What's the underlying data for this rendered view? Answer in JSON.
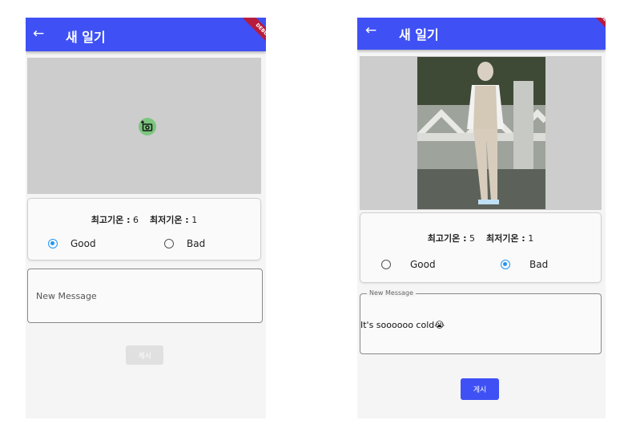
{
  "left": {
    "appbar": {
      "back_icon": "arrow-left-icon",
      "title": "새 일기",
      "debug_banner": "DEBUG"
    },
    "photo": {
      "empty": true,
      "camera_icon": "add-a-photo-icon"
    },
    "weather": {
      "max_label": "최고기온 :",
      "max_value": "6",
      "min_label": "최저기온 :",
      "min_value": "1"
    },
    "mood": {
      "options": [
        "Good",
        "Bad"
      ],
      "selected": "Good"
    },
    "message": {
      "placeholder": "New Message",
      "value": ""
    },
    "post_button": {
      "label": "게시",
      "enabled": false
    }
  },
  "right": {
    "appbar": {
      "back_icon": "arrow-left-icon",
      "title": "새 일기",
      "debug_banner": "DEBUG"
    },
    "photo": {
      "empty": false,
      "description": "photo of person standing by wall"
    },
    "weather": {
      "max_label": "최고기온 :",
      "max_value": "5",
      "min_label": "최저기온 :",
      "min_value": "1"
    },
    "mood": {
      "options": [
        "Good",
        "Bad"
      ],
      "selected": "Bad"
    },
    "message": {
      "label": "New Message",
      "value": "It's soooooo cold😭"
    },
    "post_button": {
      "label": "게시",
      "enabled": true
    }
  },
  "colors": {
    "appbar": "#3f51f5",
    "radio_active": "#2196f3",
    "debug": "#b71c3c",
    "button_enabled": "#3f51f5",
    "button_disabled": "#e0e0e0"
  }
}
